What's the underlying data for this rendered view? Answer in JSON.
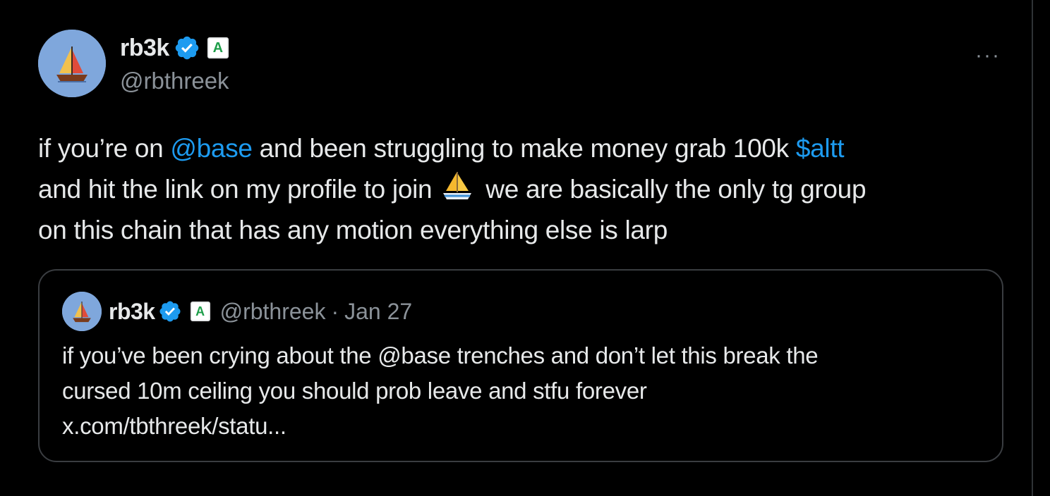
{
  "tweet": {
    "author": {
      "display_name": "rb3k",
      "handle": "@rbthreek",
      "avatar_icon": "sailboat-avatar-icon",
      "verified_icon": "verified-badge-icon",
      "affiliation_badge": "A"
    },
    "more_label": "···",
    "text": {
      "p1": "if you’re on ",
      "mention_base": "@base",
      "p2": " and been struggling to make money grab 100k ",
      "cashtag": "$altt",
      "p3": "and hit the link on my profile to join ",
      "emoji": "sailboat-emoji-icon",
      "p4": " we are basically the only tg group",
      "p5": "on this chain that has any motion everything else is larp"
    },
    "colors": {
      "background": "#000000",
      "text": "#e7e9ea",
      "secondary": "#8b9299",
      "link": "#1d9bf0",
      "verified": "#1d9bf0",
      "avatar_bg": "#7fa7dc"
    }
  },
  "quote": {
    "display_name": "rb3k",
    "affiliation_badge": "A",
    "handle": "@rbthreek",
    "separator": "·",
    "date": "Jan 27",
    "lines": [
      "if you’ve been crying about the @base trenches and don’t let this break the",
      "cursed 10m ceiling you should prob leave and stfu forever",
      "x.com/tbthreek/statu..."
    ]
  }
}
